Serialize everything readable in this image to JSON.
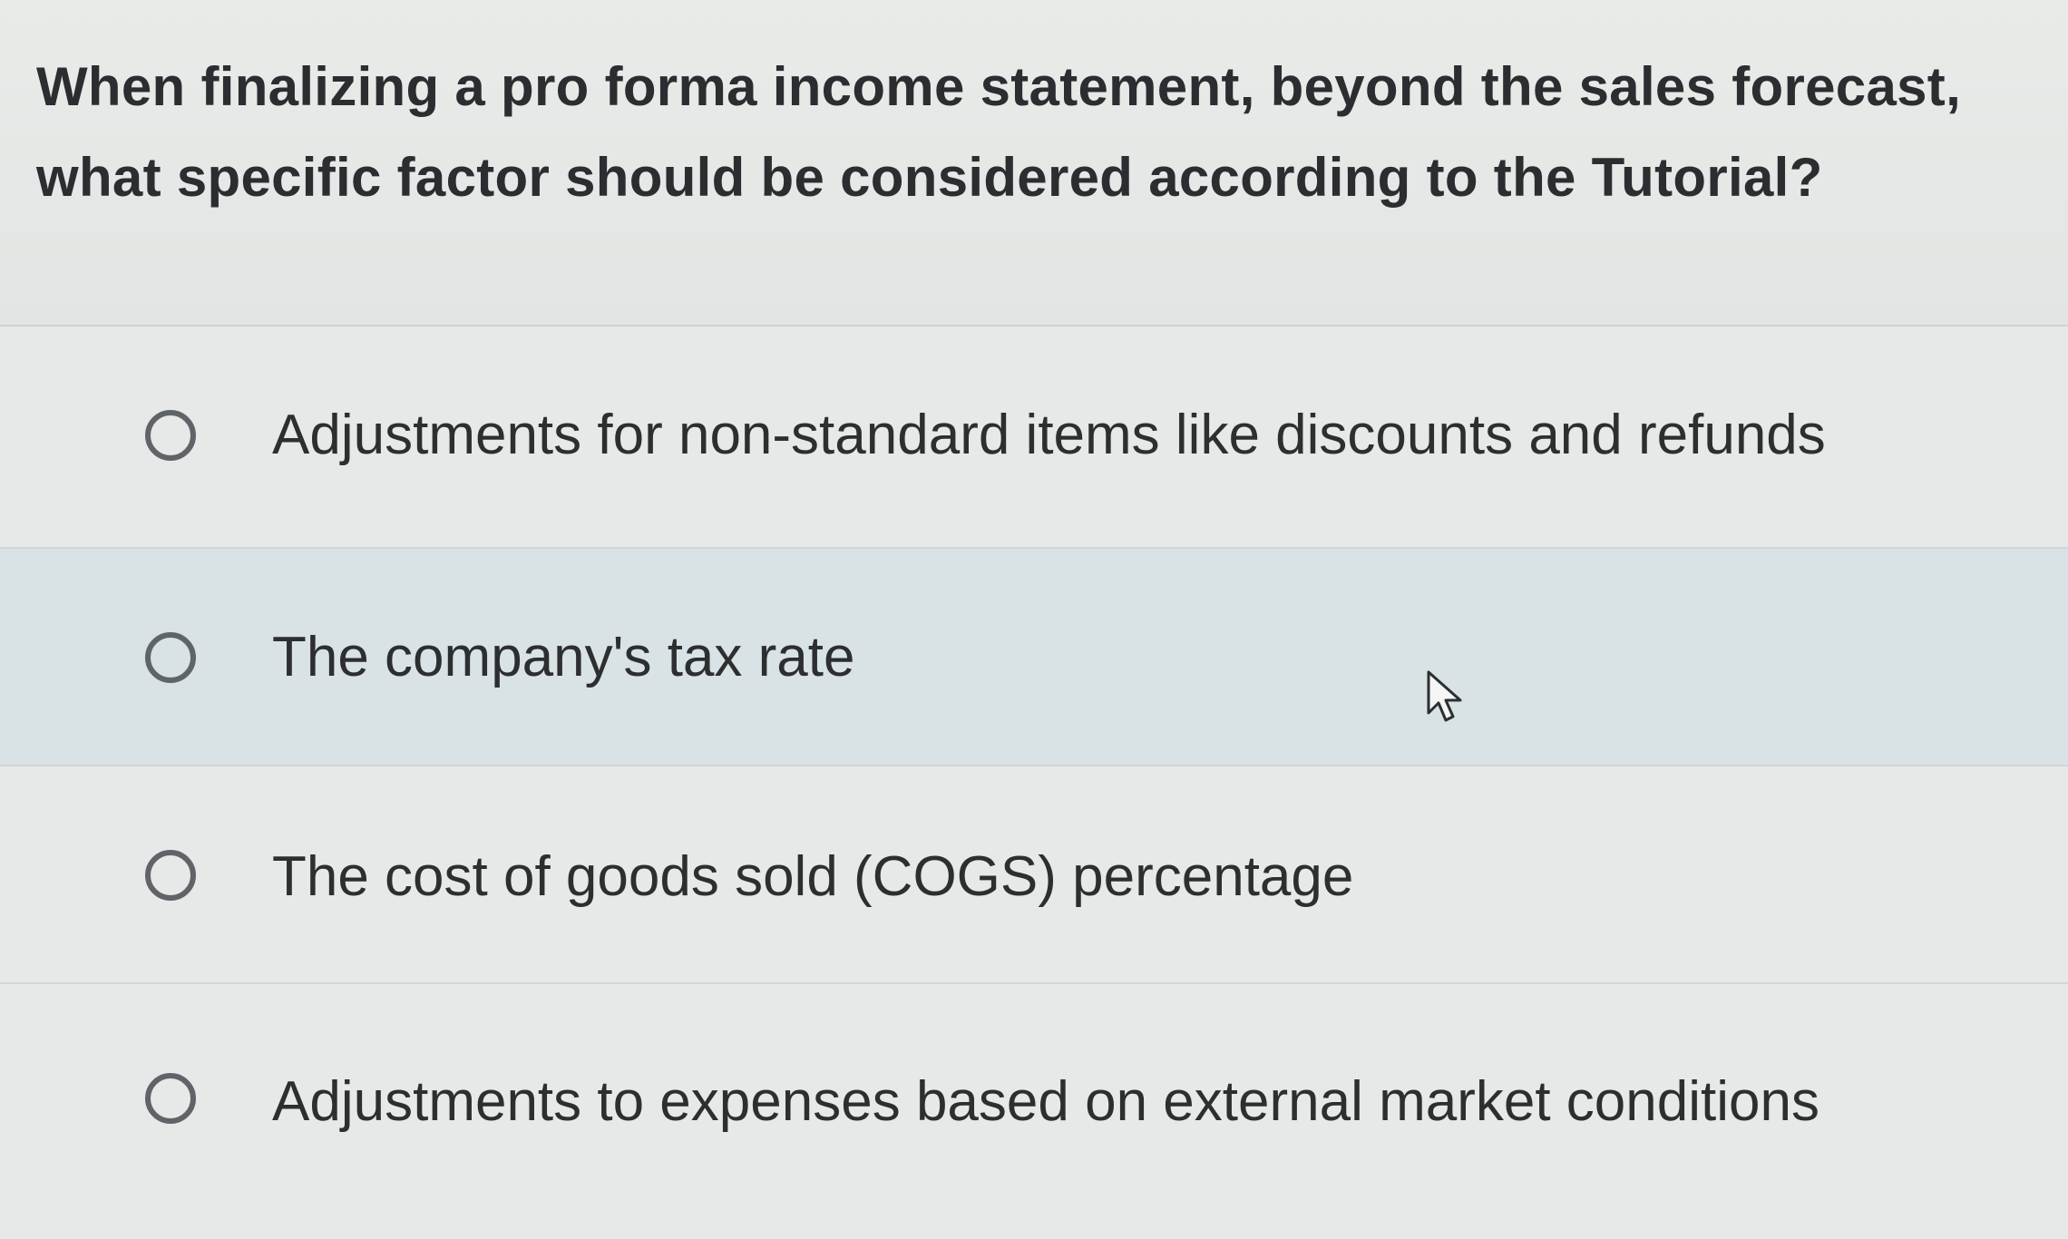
{
  "question": {
    "text": "When finalizing a pro forma income statement, beyond the sales forecast, what specific factor should be considered according to the Tutorial?"
  },
  "options": [
    {
      "label": "Adjustments for non-standard items like discounts and refunds",
      "selected": false
    },
    {
      "label": "The company's tax rate",
      "selected": false
    },
    {
      "label": "The cost of goods sold (COGS) percentage",
      "selected": false
    },
    {
      "label": "Adjustments to expenses based on external market conditions",
      "selected": false
    }
  ],
  "icons": {
    "radio": "radio-unselected-icon",
    "cursor": "mouse-pointer-icon"
  },
  "colors": {
    "background": "#e6e8e6",
    "hover_row": "#d9e2e4",
    "text": "#2c2e30",
    "radio_border": "#5f6468"
  }
}
